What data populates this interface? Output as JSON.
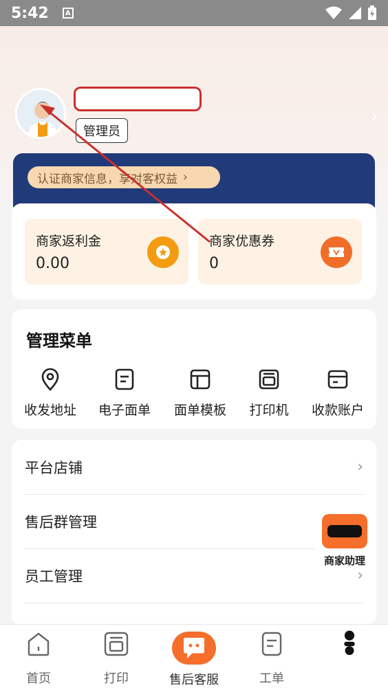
{
  "status_bar": {
    "time": "5:42",
    "notification_icon": "A"
  },
  "profile": {
    "name_value": "",
    "role": "管理员"
  },
  "promo": {
    "text": "认证商家信息，享对客权益",
    "chevron": "›"
  },
  "wallet": {
    "rebate": {
      "label": "商家返利金",
      "value": "0.00",
      "icon": "star-coin-icon"
    },
    "coupon": {
      "label": "商家优惠券",
      "value": "0",
      "icon": "ticket-icon"
    }
  },
  "management_menu": {
    "title": "管理菜单",
    "items": [
      {
        "label": "收发地址",
        "icon": "location-pin-icon"
      },
      {
        "label": "电子面单",
        "icon": "document-icon"
      },
      {
        "label": "面单模板",
        "icon": "template-icon"
      },
      {
        "label": "打印机",
        "icon": "printer-icon"
      },
      {
        "label": "收款账户",
        "icon": "card-icon"
      }
    ]
  },
  "list": {
    "items": [
      {
        "label": "平台店铺"
      },
      {
        "label": "售后群管理"
      },
      {
        "label": "员工管理"
      }
    ],
    "chevron": "›"
  },
  "helper": {
    "label": "商家助理"
  },
  "tabbar": {
    "items": [
      {
        "label": "首页",
        "icon": "home-icon"
      },
      {
        "label": "打印",
        "icon": "print-icon"
      },
      {
        "label": "售后客服",
        "icon": "chat-bubble-icon"
      },
      {
        "label": "工单",
        "icon": "work-order-icon"
      },
      {
        "label": "",
        "icon": "profile-icon"
      }
    ]
  },
  "colors": {
    "accent": "#f56e2c",
    "promo_bg": "#213a7a",
    "annotation": "#c9302c"
  }
}
